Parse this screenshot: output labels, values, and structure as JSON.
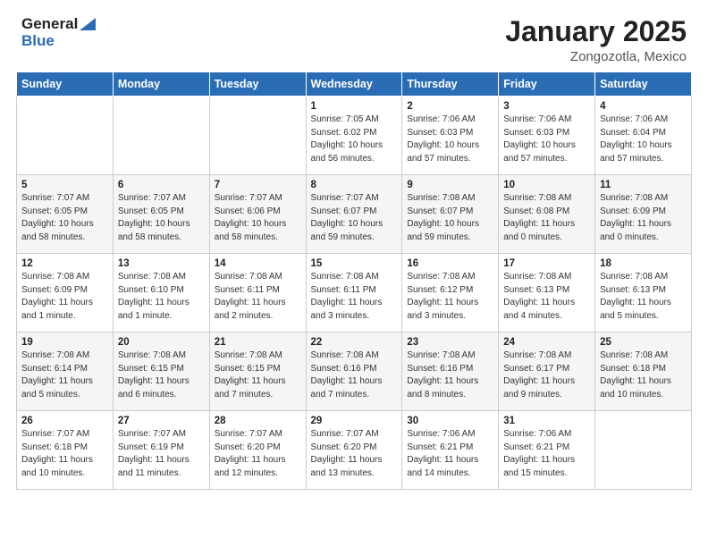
{
  "logo": {
    "general": "General",
    "blue": "Blue"
  },
  "header": {
    "month": "January 2025",
    "location": "Zongozotla, Mexico"
  },
  "days_of_week": [
    "Sunday",
    "Monday",
    "Tuesday",
    "Wednesday",
    "Thursday",
    "Friday",
    "Saturday"
  ],
  "weeks": [
    [
      {
        "num": "",
        "info": ""
      },
      {
        "num": "",
        "info": ""
      },
      {
        "num": "",
        "info": ""
      },
      {
        "num": "1",
        "info": "Sunrise: 7:05 AM\nSunset: 6:02 PM\nDaylight: 10 hours\nand 56 minutes."
      },
      {
        "num": "2",
        "info": "Sunrise: 7:06 AM\nSunset: 6:03 PM\nDaylight: 10 hours\nand 57 minutes."
      },
      {
        "num": "3",
        "info": "Sunrise: 7:06 AM\nSunset: 6:03 PM\nDaylight: 10 hours\nand 57 minutes."
      },
      {
        "num": "4",
        "info": "Sunrise: 7:06 AM\nSunset: 6:04 PM\nDaylight: 10 hours\nand 57 minutes."
      }
    ],
    [
      {
        "num": "5",
        "info": "Sunrise: 7:07 AM\nSunset: 6:05 PM\nDaylight: 10 hours\nand 58 minutes."
      },
      {
        "num": "6",
        "info": "Sunrise: 7:07 AM\nSunset: 6:05 PM\nDaylight: 10 hours\nand 58 minutes."
      },
      {
        "num": "7",
        "info": "Sunrise: 7:07 AM\nSunset: 6:06 PM\nDaylight: 10 hours\nand 58 minutes."
      },
      {
        "num": "8",
        "info": "Sunrise: 7:07 AM\nSunset: 6:07 PM\nDaylight: 10 hours\nand 59 minutes."
      },
      {
        "num": "9",
        "info": "Sunrise: 7:08 AM\nSunset: 6:07 PM\nDaylight: 10 hours\nand 59 minutes."
      },
      {
        "num": "10",
        "info": "Sunrise: 7:08 AM\nSunset: 6:08 PM\nDaylight: 11 hours\nand 0 minutes."
      },
      {
        "num": "11",
        "info": "Sunrise: 7:08 AM\nSunset: 6:09 PM\nDaylight: 11 hours\nand 0 minutes."
      }
    ],
    [
      {
        "num": "12",
        "info": "Sunrise: 7:08 AM\nSunset: 6:09 PM\nDaylight: 11 hours\nand 1 minute."
      },
      {
        "num": "13",
        "info": "Sunrise: 7:08 AM\nSunset: 6:10 PM\nDaylight: 11 hours\nand 1 minute."
      },
      {
        "num": "14",
        "info": "Sunrise: 7:08 AM\nSunset: 6:11 PM\nDaylight: 11 hours\nand 2 minutes."
      },
      {
        "num": "15",
        "info": "Sunrise: 7:08 AM\nSunset: 6:11 PM\nDaylight: 11 hours\nand 3 minutes."
      },
      {
        "num": "16",
        "info": "Sunrise: 7:08 AM\nSunset: 6:12 PM\nDaylight: 11 hours\nand 3 minutes."
      },
      {
        "num": "17",
        "info": "Sunrise: 7:08 AM\nSunset: 6:13 PM\nDaylight: 11 hours\nand 4 minutes."
      },
      {
        "num": "18",
        "info": "Sunrise: 7:08 AM\nSunset: 6:13 PM\nDaylight: 11 hours\nand 5 minutes."
      }
    ],
    [
      {
        "num": "19",
        "info": "Sunrise: 7:08 AM\nSunset: 6:14 PM\nDaylight: 11 hours\nand 5 minutes."
      },
      {
        "num": "20",
        "info": "Sunrise: 7:08 AM\nSunset: 6:15 PM\nDaylight: 11 hours\nand 6 minutes."
      },
      {
        "num": "21",
        "info": "Sunrise: 7:08 AM\nSunset: 6:15 PM\nDaylight: 11 hours\nand 7 minutes."
      },
      {
        "num": "22",
        "info": "Sunrise: 7:08 AM\nSunset: 6:16 PM\nDaylight: 11 hours\nand 7 minutes."
      },
      {
        "num": "23",
        "info": "Sunrise: 7:08 AM\nSunset: 6:16 PM\nDaylight: 11 hours\nand 8 minutes."
      },
      {
        "num": "24",
        "info": "Sunrise: 7:08 AM\nSunset: 6:17 PM\nDaylight: 11 hours\nand 9 minutes."
      },
      {
        "num": "25",
        "info": "Sunrise: 7:08 AM\nSunset: 6:18 PM\nDaylight: 11 hours\nand 10 minutes."
      }
    ],
    [
      {
        "num": "26",
        "info": "Sunrise: 7:07 AM\nSunset: 6:18 PM\nDaylight: 11 hours\nand 10 minutes."
      },
      {
        "num": "27",
        "info": "Sunrise: 7:07 AM\nSunset: 6:19 PM\nDaylight: 11 hours\nand 11 minutes."
      },
      {
        "num": "28",
        "info": "Sunrise: 7:07 AM\nSunset: 6:20 PM\nDaylight: 11 hours\nand 12 minutes."
      },
      {
        "num": "29",
        "info": "Sunrise: 7:07 AM\nSunset: 6:20 PM\nDaylight: 11 hours\nand 13 minutes."
      },
      {
        "num": "30",
        "info": "Sunrise: 7:06 AM\nSunset: 6:21 PM\nDaylight: 11 hours\nand 14 minutes."
      },
      {
        "num": "31",
        "info": "Sunrise: 7:06 AM\nSunset: 6:21 PM\nDaylight: 11 hours\nand 15 minutes."
      },
      {
        "num": "",
        "info": ""
      }
    ]
  ]
}
